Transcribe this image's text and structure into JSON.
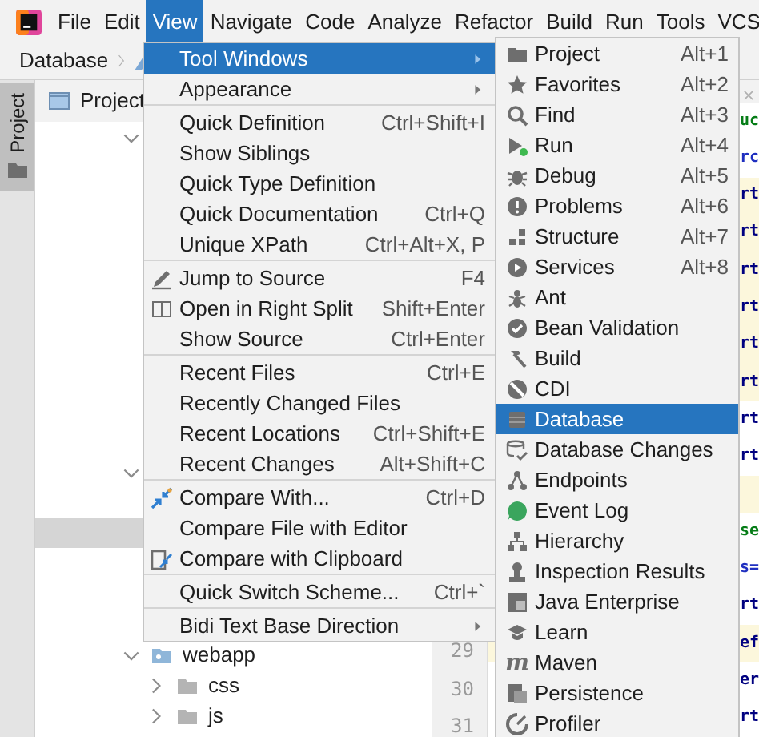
{
  "menu_bar": [
    {
      "label": "File",
      "selected": false
    },
    {
      "label": "Edit",
      "selected": false
    },
    {
      "label": "View",
      "selected": true
    },
    {
      "label": "Navigate",
      "selected": false
    },
    {
      "label": "Code",
      "selected": false
    },
    {
      "label": "Analyze",
      "selected": false
    },
    {
      "label": "Refactor",
      "selected": false
    },
    {
      "label": "Build",
      "selected": false
    },
    {
      "label": "Run",
      "selected": false
    },
    {
      "label": "Tools",
      "selected": false
    },
    {
      "label": "VCS",
      "selected": false
    }
  ],
  "breadcrumb": {
    "label": "Database"
  },
  "tool_strip": {
    "label": "Project",
    "selected": true
  },
  "project_panel": {
    "title": "Project",
    "tree": [
      {
        "expanded": true,
        "selected": false
      },
      {
        "expanded": true,
        "selected": false
      },
      {
        "selected": true
      },
      {
        "label": "webapp",
        "expanded": true,
        "selected": false,
        "children": [
          {
            "label": "css",
            "expanded": false,
            "selected": false
          },
          {
            "label": "js",
            "expanded": false,
            "selected": false
          }
        ]
      }
    ]
  },
  "editor": {
    "lines": [
      {
        "text": "uc",
        "kind": "string",
        "highlighted": false
      },
      {
        "text": "rc",
        "kind": "attr",
        "highlighted": false
      },
      {
        "text": "rt",
        "kind": "tag",
        "highlighted": true
      },
      {
        "text": "rt",
        "kind": "tag",
        "highlighted": true
      },
      {
        "text": "rt",
        "kind": "tag",
        "highlighted": true
      },
      {
        "text": "rt",
        "kind": "tag",
        "highlighted": true
      },
      {
        "text": "rt",
        "kind": "tag",
        "highlighted": true
      },
      {
        "text": "rt",
        "kind": "tag",
        "highlighted": true
      },
      {
        "text": "rt",
        "kind": "tag",
        "highlighted": false
      },
      {
        "text": "rt",
        "kind": "tag",
        "highlighted": false
      },
      {
        "kind": "blank",
        "highlighted": true
      },
      {
        "text": "se",
        "kind": "string",
        "highlighted": false
      },
      {
        "text": "s=",
        "kind": "attr",
        "highlighted": false
      },
      {
        "text": "rt",
        "kind": "tag",
        "highlighted": false
      },
      {
        "number": "29",
        "text": "ef",
        "kind": "tag",
        "highlighted": true
      },
      {
        "number": "30",
        "text": "er",
        "kind": "tag",
        "highlighted": false
      },
      {
        "number": "31",
        "text": "rt",
        "kind": "tag",
        "highlighted": false
      }
    ]
  },
  "view_menu": {
    "sections": [
      [
        {
          "label": "Tool Windows",
          "submenu": true,
          "selected": true
        },
        {
          "label": "Appearance",
          "submenu": true,
          "selected": false
        }
      ],
      [
        {
          "label": "Quick Definition",
          "shortcut": "Ctrl+Shift+I",
          "submenu": false,
          "selected": false
        },
        {
          "label": "Show Siblings",
          "submenu": false,
          "selected": false
        },
        {
          "label": "Quick Type Definition",
          "submenu": false,
          "selected": false
        },
        {
          "label": "Quick Documentation",
          "shortcut": "Ctrl+Q",
          "submenu": false,
          "selected": false
        },
        {
          "label": "Unique XPath",
          "shortcut": "Ctrl+Alt+X, P",
          "submenu": false,
          "selected": false
        }
      ],
      [
        {
          "label": "Jump to Source",
          "shortcut": "F4",
          "submenu": false,
          "selected": false
        },
        {
          "label": "Open in Right Split",
          "shortcut": "Shift+Enter",
          "submenu": false,
          "selected": false
        },
        {
          "label": "Show Source",
          "shortcut": "Ctrl+Enter",
          "submenu": false,
          "selected": false
        }
      ],
      [
        {
          "label": "Recent Files",
          "shortcut": "Ctrl+E",
          "submenu": false,
          "selected": false
        },
        {
          "label": "Recently Changed Files",
          "submenu": false,
          "selected": false
        },
        {
          "label": "Recent Locations",
          "shortcut": "Ctrl+Shift+E",
          "submenu": false,
          "selected": false
        },
        {
          "label": "Recent Changes",
          "shortcut": "Alt+Shift+C",
          "submenu": false,
          "selected": false
        }
      ],
      [
        {
          "label": "Compare With...",
          "shortcut": "Ctrl+D",
          "submenu": false,
          "selected": false
        },
        {
          "label": "Compare File with Editor",
          "submenu": false,
          "selected": false
        },
        {
          "label": "Compare with Clipboard",
          "submenu": false,
          "selected": false
        }
      ],
      [
        {
          "label": "Quick Switch Scheme...",
          "shortcut": "Ctrl+`",
          "submenu": false,
          "selected": false
        }
      ],
      [
        {
          "label": "Bidi Text Base Direction",
          "submenu": true,
          "selected": false
        }
      ]
    ]
  },
  "tool_windows_menu": {
    "items": [
      {
        "label": "Project",
        "shortcut": "Alt+1",
        "selected": false
      },
      {
        "label": "Favorites",
        "shortcut": "Alt+2",
        "selected": false
      },
      {
        "label": "Find",
        "shortcut": "Alt+3",
        "selected": false
      },
      {
        "label": "Run",
        "shortcut": "Alt+4",
        "selected": false
      },
      {
        "label": "Debug",
        "shortcut": "Alt+5",
        "selected": false
      },
      {
        "label": "Problems",
        "shortcut": "Alt+6",
        "selected": false
      },
      {
        "label": "Structure",
        "shortcut": "Alt+7",
        "selected": false
      },
      {
        "label": "Services",
        "shortcut": "Alt+8",
        "selected": false
      },
      {
        "label": "Ant",
        "selected": false
      },
      {
        "label": "Bean Validation",
        "selected": false
      },
      {
        "label": "Build",
        "selected": false
      },
      {
        "label": "CDI",
        "selected": false
      },
      {
        "label": "Database",
        "selected": true
      },
      {
        "label": "Database Changes",
        "selected": false
      },
      {
        "label": "Endpoints",
        "selected": false
      },
      {
        "label": "Event Log",
        "selected": false
      },
      {
        "label": "Hierarchy",
        "selected": false
      },
      {
        "label": "Inspection Results",
        "selected": false
      },
      {
        "label": "Java Enterprise",
        "selected": false
      },
      {
        "label": "Learn",
        "selected": false
      },
      {
        "label": "Maven",
        "icon_text": "m",
        "selected": false
      },
      {
        "label": "Persistence",
        "selected": false
      },
      {
        "label": "Profiler",
        "selected": false
      }
    ]
  }
}
